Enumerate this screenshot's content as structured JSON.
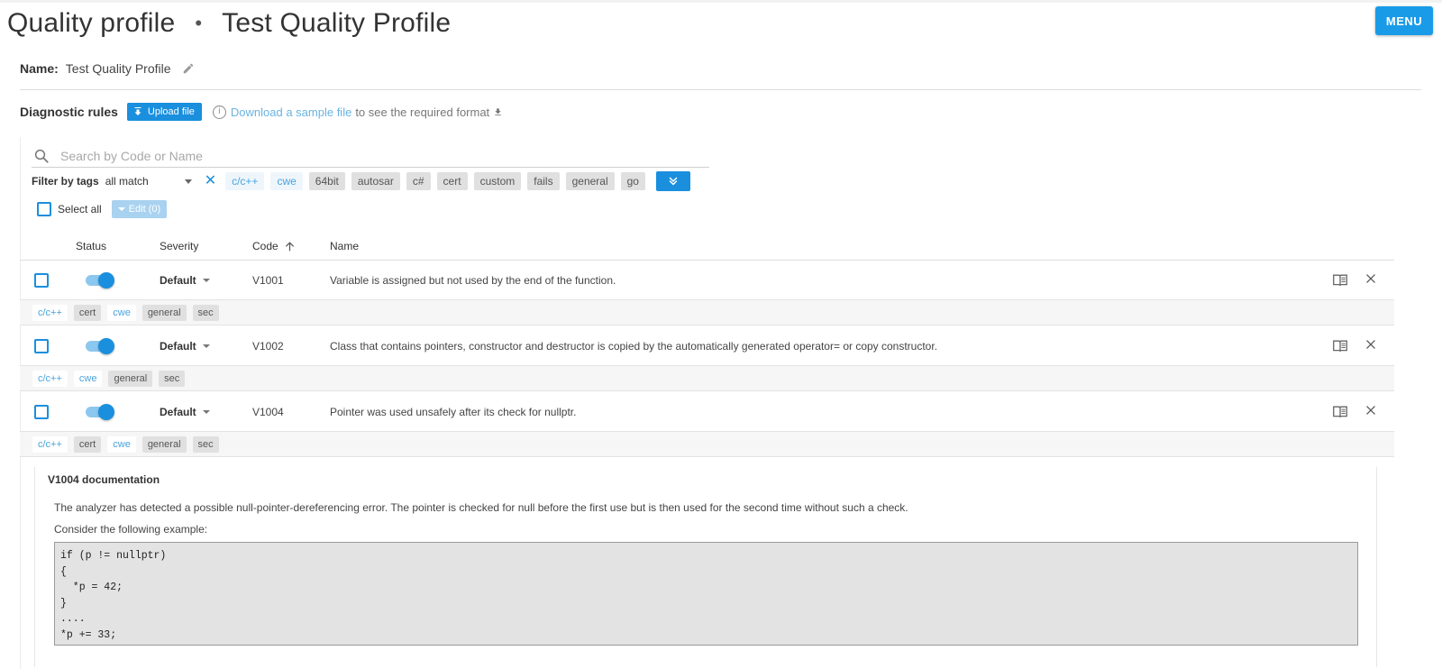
{
  "header": {
    "section": "Quality profile",
    "profile": "Test Quality Profile",
    "menu_label": "MENU"
  },
  "name_row": {
    "label": "Name:",
    "value": "Test Quality Profile"
  },
  "diagnostic": {
    "label": "Diagnostic rules",
    "upload_label": "Upload file",
    "download_link": "Download a sample file",
    "download_rest": "to see the required format"
  },
  "search": {
    "placeholder": "Search by Code or Name"
  },
  "filter": {
    "label": "Filter by tags",
    "mode": "all match",
    "selected_tags": [
      "c/c++",
      "cwe"
    ],
    "available_tags": [
      "64bit",
      "autosar",
      "c#",
      "cert",
      "custom",
      "fails",
      "general",
      "go"
    ]
  },
  "select_all_label": "Select all",
  "edit_label": "Edit (0)",
  "table": {
    "headers": {
      "status": "Status",
      "severity": "Severity",
      "code": "Code",
      "name": "Name"
    },
    "rows": [
      {
        "severity": "Default",
        "code": "V1001",
        "name": "Variable is assigned but not used by the end of the function.",
        "enabled": true,
        "tags": [
          "c/c++",
          "cert",
          "cwe",
          "general",
          "sec"
        ]
      },
      {
        "severity": "Default",
        "code": "V1002",
        "name": "Class that contains pointers, constructor and destructor is copied by the automatically generated operator= or copy constructor.",
        "enabled": true,
        "tags": [
          "c/c++",
          "cwe",
          "general",
          "sec"
        ]
      },
      {
        "severity": "Default",
        "code": "V1004",
        "name": "Pointer was used unsafely after its check for nullptr.",
        "enabled": true,
        "tags": [
          "c/c++",
          "cert",
          "cwe",
          "general",
          "sec"
        ]
      }
    ]
  },
  "documentation": {
    "title": "V1004 documentation",
    "paragraph1": "The analyzer has detected a possible null-pointer-dereferencing error. The pointer is checked for null before the first use but is then used for the second time without such a check.",
    "paragraph2": "Consider the following example:",
    "code": "if (p != nullptr)\n{\n  *p = 42;\n}\n....\n*p += 33;"
  },
  "colors": {
    "accent": "#1a8fde",
    "selected_tag_text": "#4aa3dc",
    "tag_gray": "#e0e0e0"
  },
  "icons": {
    "edit_name": "pencil-icon",
    "upload": "upload-icon",
    "info": "info-icon",
    "download": "download-icon",
    "search": "search-icon",
    "clear_filter": "close-icon",
    "expand_tags": "double-chevron-down-icon",
    "sort": "arrow-up-icon",
    "docs": "book-icon",
    "remove_rule": "close-icon"
  }
}
